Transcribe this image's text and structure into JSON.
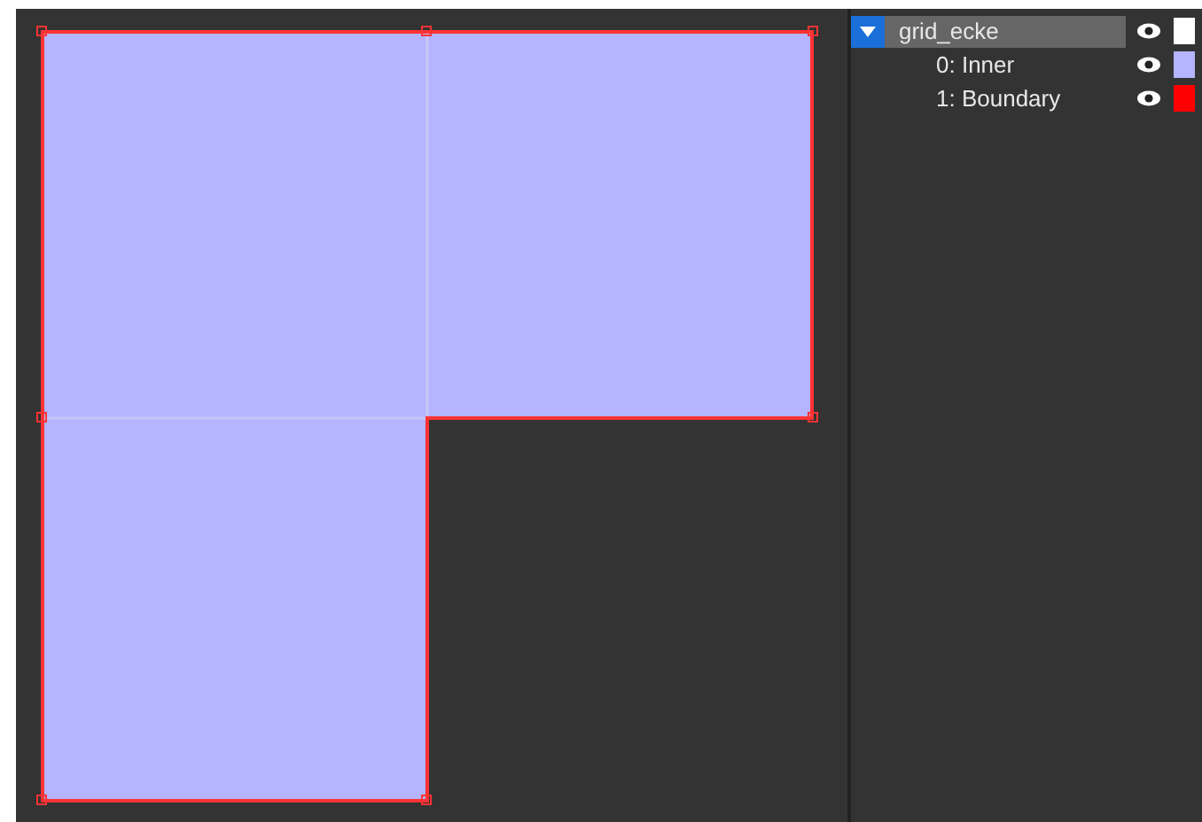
{
  "layers": [
    {
      "name": "grid_ecke",
      "expanded": true,
      "selected": true,
      "visible": true,
      "color": "#ffffff",
      "children": [
        {
          "name": "0: Inner",
          "selected": false,
          "visible": true,
          "color": "#b4b4ff"
        },
        {
          "name": "1: Boundary",
          "selected": false,
          "visible": true,
          "color": "#ff0000"
        }
      ]
    }
  ]
}
